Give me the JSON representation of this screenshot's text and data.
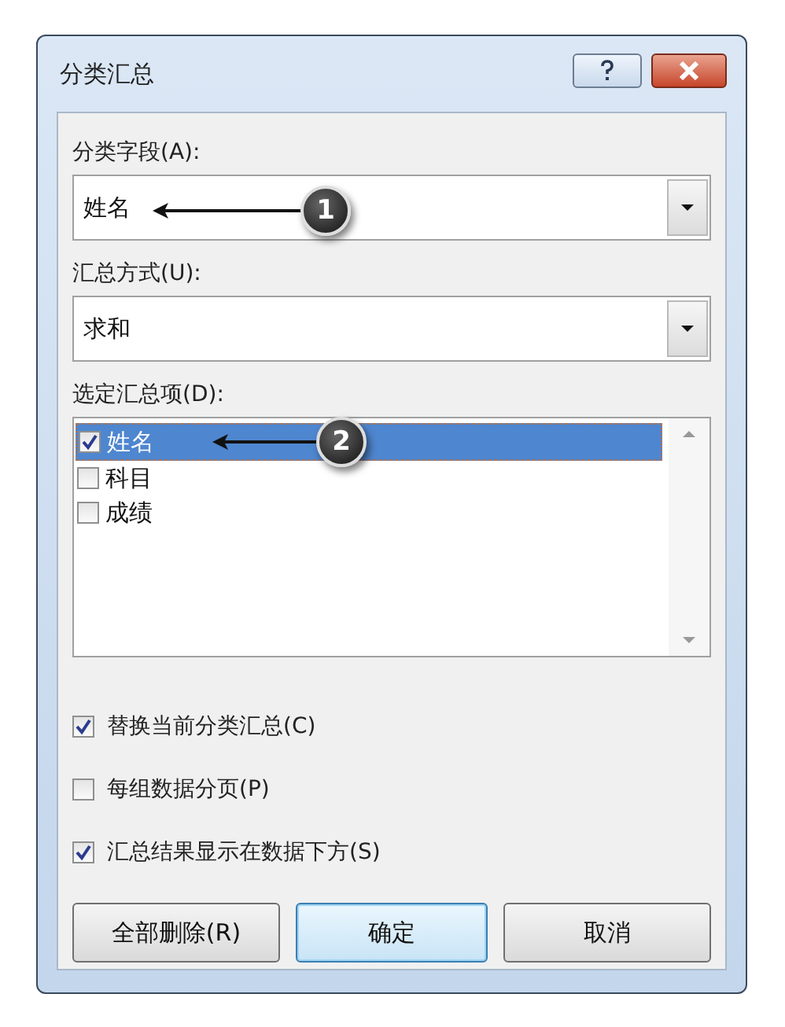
{
  "window": {
    "title": "分类汇总"
  },
  "fields": [
    {
      "label": "分类字段(A):",
      "value": "姓名",
      "callout": "1"
    },
    {
      "label": "汇总方式(U):",
      "value": "求和"
    }
  ],
  "list": {
    "label": "选定汇总项(D):",
    "items": [
      {
        "text": "姓名",
        "checked": true,
        "selected": true,
        "callout": "2"
      },
      {
        "text": "科目",
        "checked": false,
        "selected": false
      },
      {
        "text": "成绩",
        "checked": false,
        "selected": false
      }
    ]
  },
  "options": [
    {
      "label": "替换当前分类汇总(C)",
      "checked": true
    },
    {
      "label": "每组数据分页(P)",
      "checked": false
    },
    {
      "label": "汇总结果显示在数据下方(S)",
      "checked": true
    }
  ],
  "buttons": [
    {
      "label": "全部删除(R)",
      "default": false
    },
    {
      "label": "确定",
      "default": true
    },
    {
      "label": "取消",
      "default": false
    }
  ]
}
